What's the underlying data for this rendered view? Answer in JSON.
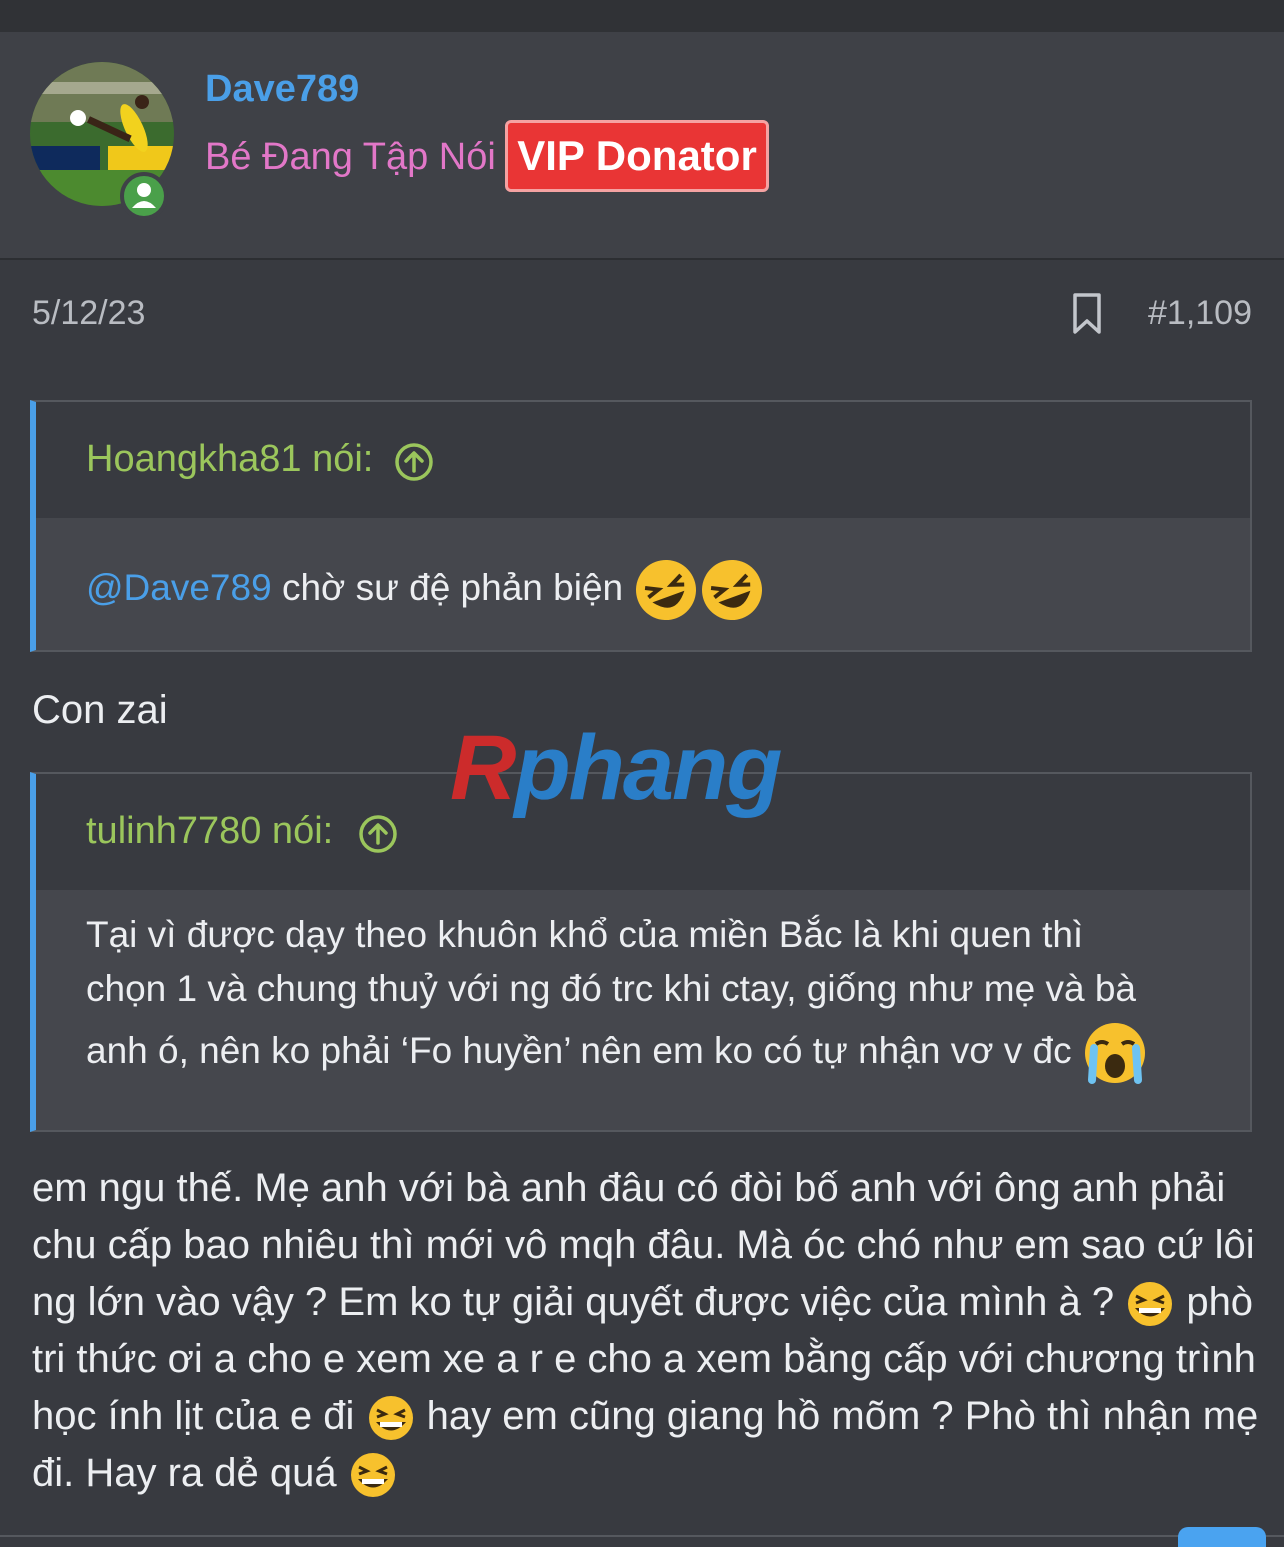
{
  "post": {
    "username": "Dave789",
    "user_title": "Bé Đang Tập Nói",
    "badge": "VIP Donator",
    "date": "5/12/23",
    "post_number": "#1,109"
  },
  "quote1": {
    "author": "Hoangkha81 nói:",
    "mention": "@Dave789",
    "text": " chờ sư đệ phản biện "
  },
  "reply1": "Con zai",
  "watermark": {
    "part1": "R",
    "part2": "phang"
  },
  "quote2": {
    "author": "tulinh7780 nói:",
    "line1": "Tại vì được dạy theo khuôn khổ của miền Bắc là khi quen thì",
    "line2": "chọn 1 và chung thuỷ với ng đó trc khi ctay, giống như mẹ và bà",
    "line3": "anh ó, nên ko phải ‘Fo huyền’ nên em ko có tự nhận vơ v đc "
  },
  "reply2": {
    "part1": "em ngu thế. Mẹ anh với bà anh đâu có đòi bố anh với ông anh phải chu cấp bao nhiêu thì mới vô mqh đâu. Mà óc chó như em sao cứ lôi ng lớn vào vậy ? Em ko tự giải quyết được việc của mình à ? ",
    "part2": " phò tri thức ơi a cho e xem xe a r e cho a xem bằng cấp với chương trình học ính lịt của e đi ",
    "part3": " hay em cũng giang hồ mõm ? Phò thì nhận mẹ đi. Hay ra dẻ quá "
  },
  "colors": {
    "accent": "#4a9fe8",
    "username": "#4a9fe8",
    "user_title": "#e277c8",
    "vip_bg": "#e93535",
    "quote_author": "#9bc65c",
    "background": "#383a40"
  }
}
